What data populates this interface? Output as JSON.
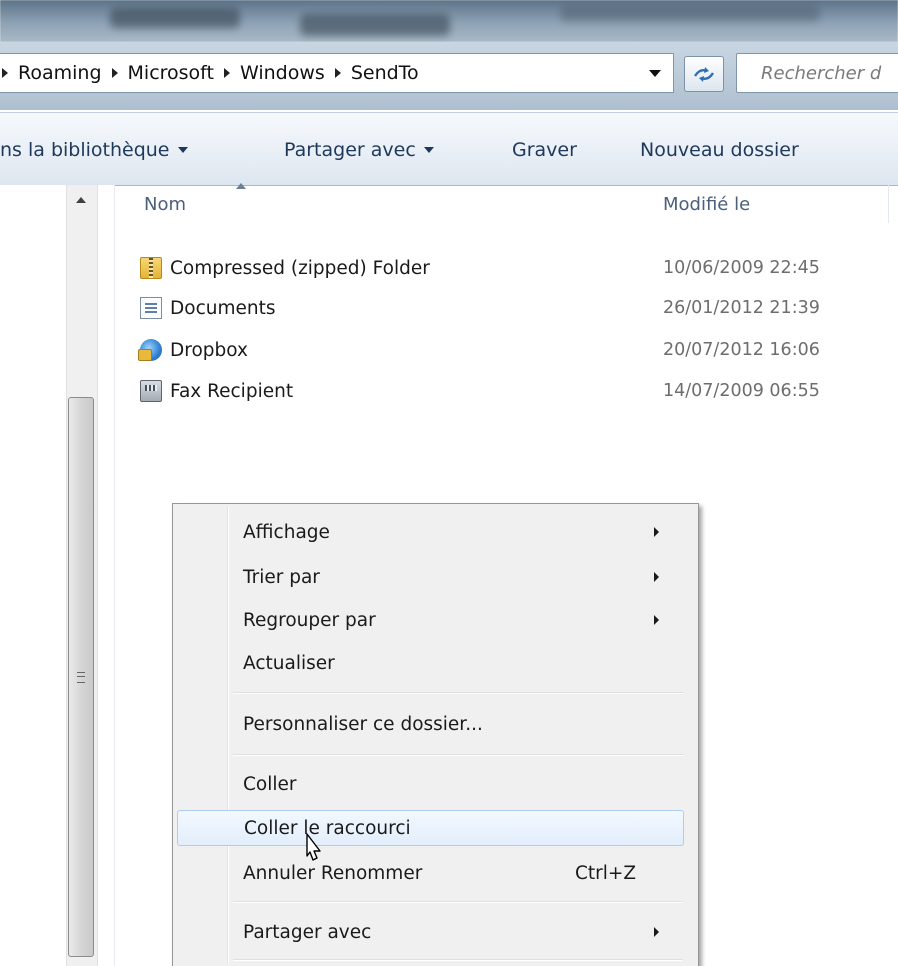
{
  "address_bar": {
    "breadcrumbs": [
      "Roaming",
      "Microsoft",
      "Windows",
      "SendTo"
    ],
    "search_placeholder": "Rechercher d"
  },
  "toolbar": {
    "include_in_library_label": "ns la bibliothèque",
    "share_with_label": "Partager avec",
    "burn_label": "Graver",
    "new_folder_label": "Nouveau dossier"
  },
  "file_list": {
    "columns": {
      "name": "Nom",
      "modified": "Modifié le"
    },
    "sort_column": "Nom",
    "files": [
      {
        "name": "Compressed (zipped) Folder",
        "modified": "10/06/2009 22:45",
        "icon": "zip-folder-icon"
      },
      {
        "name": "Documents",
        "modified": "26/01/2012 21:39",
        "icon": "document-icon"
      },
      {
        "name": "Dropbox",
        "modified": "20/07/2012 16:06",
        "icon": "dropbox-icon"
      },
      {
        "name": "Fax Recipient",
        "modified": "14/07/2009 06:55",
        "icon": "fax-icon"
      }
    ]
  },
  "context_menu": {
    "items": [
      {
        "label": "Affichage",
        "submenu": true
      },
      {
        "label": "Trier par",
        "submenu": true
      },
      {
        "label": "Regrouper par",
        "submenu": true
      },
      {
        "label": "Actualiser",
        "submenu": false
      },
      {
        "label": "Personnaliser ce dossier...",
        "submenu": false
      },
      {
        "label": "Coller",
        "submenu": false
      },
      {
        "label": "Coller le raccourci",
        "submenu": false,
        "highlighted": true
      },
      {
        "label": "Annuler Renommer",
        "shortcut": "Ctrl+Z",
        "submenu": false
      },
      {
        "label": "Partager avec",
        "submenu": true
      }
    ]
  },
  "colors": {
    "command_text": "#1e395b",
    "hover_border": "#aeccf1",
    "menu_background": "#f0f0f0"
  }
}
